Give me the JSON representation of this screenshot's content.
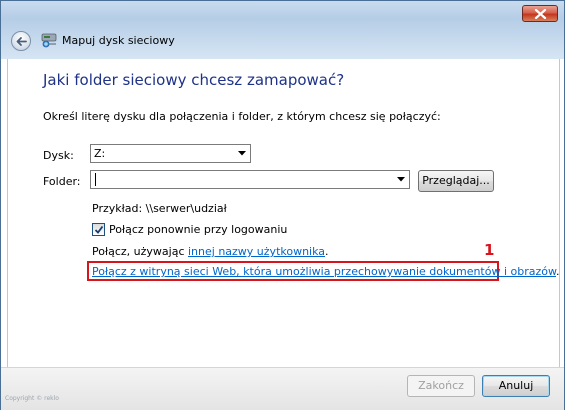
{
  "window": {
    "title": "Mapuj dysk sieciowy"
  },
  "heading": "Jaki folder sieciowy chcesz zamapować?",
  "intro": "Określ literę dysku dla połączenia i folder, z którym chcesz się połączyć:",
  "drive": {
    "label": "Dysk:",
    "value": "Z:"
  },
  "folder": {
    "label": "Folder:",
    "value": ""
  },
  "browse_button": "Przeglądaj...",
  "example": "Przykład: \\\\serwer\\udział",
  "reconnect": {
    "label": "Połącz ponownie przy logowaniu",
    "checked": true
  },
  "connect_as": {
    "prefix": "Połącz, używając ",
    "link": "innej nazwy użytkownika",
    "suffix": "."
  },
  "web_link": {
    "text": "Połącz z witryną sieci Web, która umożliwia przechowywanie dokumentów i obrazów",
    "suffix": "."
  },
  "annotation_marker": "1",
  "footer": {
    "finish_label": "Zakończ",
    "cancel_label": "Anuluj"
  },
  "copyright": "Copyright © reklo",
  "colors": {
    "heading": "#1e3287",
    "link": "#0066cc",
    "highlight": "#d8141c"
  },
  "icons": [
    "close-icon",
    "back-arrow-icon",
    "network-drive-icon",
    "chevron-down-icon",
    "checkmark-icon"
  ]
}
